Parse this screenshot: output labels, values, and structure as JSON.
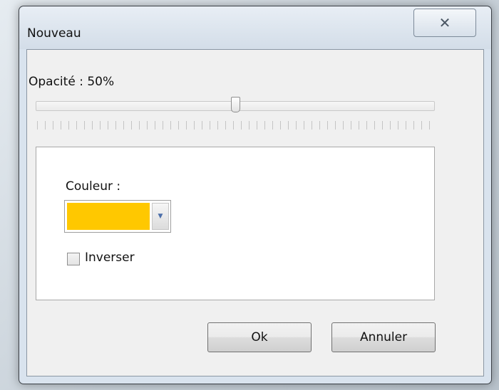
{
  "window": {
    "title": "Nouveau",
    "close_icon": "close-icon",
    "close_glyph": "✕"
  },
  "opacity": {
    "label": "Opacité : 50%",
    "value_percent": 50
  },
  "color": {
    "label": "Couleur :",
    "selected": "#ffc800",
    "dropdown_icon": "chevron-down-icon",
    "dropdown_glyph": "▼"
  },
  "invert": {
    "label": "Inverser",
    "checked": false
  },
  "buttons": {
    "ok": "Ok",
    "cancel": "Annuler"
  }
}
